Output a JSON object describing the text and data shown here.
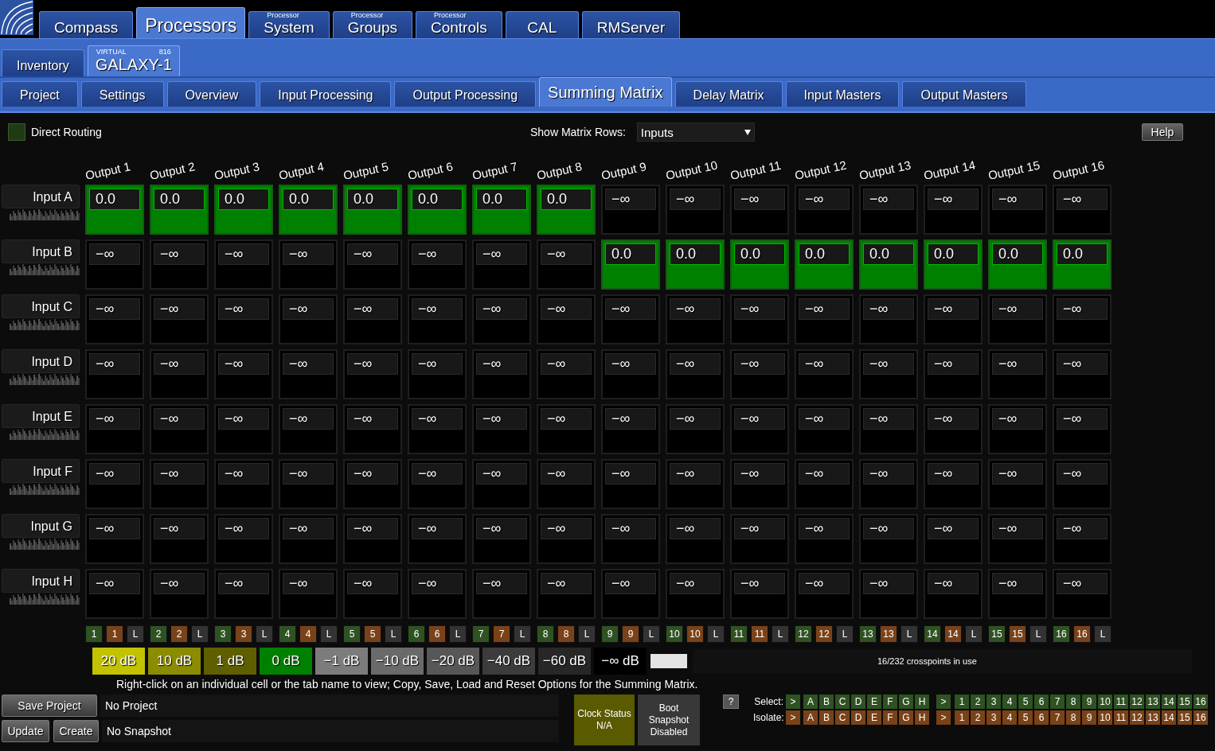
{
  "top_tabs": [
    {
      "label": "Compass",
      "selected": false
    },
    {
      "label": "Processors",
      "selected": true
    },
    {
      "caption": "Processor",
      "label": "System",
      "selected": false
    },
    {
      "caption": "Processor",
      "label": "Groups",
      "selected": false
    },
    {
      "caption": "Processor",
      "label": "Controls",
      "selected": false
    },
    {
      "label": "CAL",
      "selected": false
    },
    {
      "label": "RMServer",
      "selected": false
    }
  ],
  "device_tabs": [
    {
      "label": "Inventory",
      "selected": false
    },
    {
      "caption": "VIRTUAL",
      "badge": "816",
      "label": "GALAXY-1",
      "selected": true
    }
  ],
  "page_tabs": [
    {
      "label": "Project",
      "selected": false
    },
    {
      "label": "Settings",
      "selected": false
    },
    {
      "label": "Overview",
      "selected": false
    },
    {
      "label": "Input Processing",
      "selected": false
    },
    {
      "label": "Output Processing",
      "selected": false
    },
    {
      "label": "Summing Matrix",
      "selected": true
    },
    {
      "label": "Delay Matrix",
      "selected": false
    },
    {
      "label": "Input Masters",
      "selected": false
    },
    {
      "label": "Output Masters",
      "selected": false
    }
  ],
  "toolbar": {
    "direct_routing": {
      "label": "Direct Routing",
      "checked": false
    },
    "matrix_rows": {
      "label": "Show Matrix Rows:",
      "value": "Inputs"
    },
    "help": "Help"
  },
  "matrix": {
    "columns": [
      "Output 1",
      "Output 2",
      "Output 3",
      "Output 4",
      "Output 5",
      "Output 6",
      "Output 7",
      "Output 8",
      "Output 9",
      "Output 10",
      "Output 11",
      "Output 12",
      "Output 13",
      "Output 14",
      "Output 15",
      "Output 16"
    ],
    "rows": [
      {
        "label": "Input A",
        "cells": [
          {
            "value": "0.0",
            "on": true
          },
          {
            "value": "0.0",
            "on": true
          },
          {
            "value": "0.0",
            "on": true
          },
          {
            "value": "0.0",
            "on": true
          },
          {
            "value": "0.0",
            "on": true
          },
          {
            "value": "0.0",
            "on": true
          },
          {
            "value": "0.0",
            "on": true
          },
          {
            "value": "0.0",
            "on": true
          },
          {
            "value": "−∞",
            "on": false
          },
          {
            "value": "−∞",
            "on": false
          },
          {
            "value": "−∞",
            "on": false
          },
          {
            "value": "−∞",
            "on": false
          },
          {
            "value": "−∞",
            "on": false
          },
          {
            "value": "−∞",
            "on": false
          },
          {
            "value": "−∞",
            "on": false
          },
          {
            "value": "−∞",
            "on": false
          }
        ]
      },
      {
        "label": "Input B",
        "cells": [
          {
            "value": "−∞",
            "on": false
          },
          {
            "value": "−∞",
            "on": false
          },
          {
            "value": "−∞",
            "on": false
          },
          {
            "value": "−∞",
            "on": false
          },
          {
            "value": "−∞",
            "on": false
          },
          {
            "value": "−∞",
            "on": false
          },
          {
            "value": "−∞",
            "on": false
          },
          {
            "value": "−∞",
            "on": false
          },
          {
            "value": "0.0",
            "on": true
          },
          {
            "value": "0.0",
            "on": true
          },
          {
            "value": "0.0",
            "on": true
          },
          {
            "value": "0.0",
            "on": true
          },
          {
            "value": "0.0",
            "on": true
          },
          {
            "value": "0.0",
            "on": true
          },
          {
            "value": "0.0",
            "on": true
          },
          {
            "value": "0.0",
            "on": true
          }
        ]
      },
      {
        "label": "Input C",
        "cells": [
          {
            "value": "−∞",
            "on": false
          },
          {
            "value": "−∞",
            "on": false
          },
          {
            "value": "−∞",
            "on": false
          },
          {
            "value": "−∞",
            "on": false
          },
          {
            "value": "−∞",
            "on": false
          },
          {
            "value": "−∞",
            "on": false
          },
          {
            "value": "−∞",
            "on": false
          },
          {
            "value": "−∞",
            "on": false
          },
          {
            "value": "−∞",
            "on": false
          },
          {
            "value": "−∞",
            "on": false
          },
          {
            "value": "−∞",
            "on": false
          },
          {
            "value": "−∞",
            "on": false
          },
          {
            "value": "−∞",
            "on": false
          },
          {
            "value": "−∞",
            "on": false
          },
          {
            "value": "−∞",
            "on": false
          },
          {
            "value": "−∞",
            "on": false
          }
        ]
      },
      {
        "label": "Input D",
        "cells": [
          {
            "value": "−∞",
            "on": false
          },
          {
            "value": "−∞",
            "on": false
          },
          {
            "value": "−∞",
            "on": false
          },
          {
            "value": "−∞",
            "on": false
          },
          {
            "value": "−∞",
            "on": false
          },
          {
            "value": "−∞",
            "on": false
          },
          {
            "value": "−∞",
            "on": false
          },
          {
            "value": "−∞",
            "on": false
          },
          {
            "value": "−∞",
            "on": false
          },
          {
            "value": "−∞",
            "on": false
          },
          {
            "value": "−∞",
            "on": false
          },
          {
            "value": "−∞",
            "on": false
          },
          {
            "value": "−∞",
            "on": false
          },
          {
            "value": "−∞",
            "on": false
          },
          {
            "value": "−∞",
            "on": false
          },
          {
            "value": "−∞",
            "on": false
          }
        ]
      },
      {
        "label": "Input E",
        "cells": [
          {
            "value": "−∞",
            "on": false
          },
          {
            "value": "−∞",
            "on": false
          },
          {
            "value": "−∞",
            "on": false
          },
          {
            "value": "−∞",
            "on": false
          },
          {
            "value": "−∞",
            "on": false
          },
          {
            "value": "−∞",
            "on": false
          },
          {
            "value": "−∞",
            "on": false
          },
          {
            "value": "−∞",
            "on": false
          },
          {
            "value": "−∞",
            "on": false
          },
          {
            "value": "−∞",
            "on": false
          },
          {
            "value": "−∞",
            "on": false
          },
          {
            "value": "−∞",
            "on": false
          },
          {
            "value": "−∞",
            "on": false
          },
          {
            "value": "−∞",
            "on": false
          },
          {
            "value": "−∞",
            "on": false
          },
          {
            "value": "−∞",
            "on": false
          }
        ]
      },
      {
        "label": "Input F",
        "cells": [
          {
            "value": "−∞",
            "on": false
          },
          {
            "value": "−∞",
            "on": false
          },
          {
            "value": "−∞",
            "on": false
          },
          {
            "value": "−∞",
            "on": false
          },
          {
            "value": "−∞",
            "on": false
          },
          {
            "value": "−∞",
            "on": false
          },
          {
            "value": "−∞",
            "on": false
          },
          {
            "value": "−∞",
            "on": false
          },
          {
            "value": "−∞",
            "on": false
          },
          {
            "value": "−∞",
            "on": false
          },
          {
            "value": "−∞",
            "on": false
          },
          {
            "value": "−∞",
            "on": false
          },
          {
            "value": "−∞",
            "on": false
          },
          {
            "value": "−∞",
            "on": false
          },
          {
            "value": "−∞",
            "on": false
          },
          {
            "value": "−∞",
            "on": false
          }
        ]
      },
      {
        "label": "Input G",
        "cells": [
          {
            "value": "−∞",
            "on": false
          },
          {
            "value": "−∞",
            "on": false
          },
          {
            "value": "−∞",
            "on": false
          },
          {
            "value": "−∞",
            "on": false
          },
          {
            "value": "−∞",
            "on": false
          },
          {
            "value": "−∞",
            "on": false
          },
          {
            "value": "−∞",
            "on": false
          },
          {
            "value": "−∞",
            "on": false
          },
          {
            "value": "−∞",
            "on": false
          },
          {
            "value": "−∞",
            "on": false
          },
          {
            "value": "−∞",
            "on": false
          },
          {
            "value": "−∞",
            "on": false
          },
          {
            "value": "−∞",
            "on": false
          },
          {
            "value": "−∞",
            "on": false
          },
          {
            "value": "−∞",
            "on": false
          },
          {
            "value": "−∞",
            "on": false
          }
        ]
      },
      {
        "label": "Input H",
        "cells": [
          {
            "value": "−∞",
            "on": false
          },
          {
            "value": "−∞",
            "on": false
          },
          {
            "value": "−∞",
            "on": false
          },
          {
            "value": "−∞",
            "on": false
          },
          {
            "value": "−∞",
            "on": false
          },
          {
            "value": "−∞",
            "on": false
          },
          {
            "value": "−∞",
            "on": false
          },
          {
            "value": "−∞",
            "on": false
          },
          {
            "value": "−∞",
            "on": false
          },
          {
            "value": "−∞",
            "on": false
          },
          {
            "value": "−∞",
            "on": false
          },
          {
            "value": "−∞",
            "on": false
          },
          {
            "value": "−∞",
            "on": false
          },
          {
            "value": "−∞",
            "on": false
          },
          {
            "value": "−∞",
            "on": false
          },
          {
            "value": "−∞",
            "on": false
          }
        ]
      }
    ]
  },
  "output_buttons": [
    {
      "select": "1",
      "isolate": "1",
      "link": "L"
    },
    {
      "select": "2",
      "isolate": "2",
      "link": "L"
    },
    {
      "select": "3",
      "isolate": "3",
      "link": "L"
    },
    {
      "select": "4",
      "isolate": "4",
      "link": "L"
    },
    {
      "select": "5",
      "isolate": "5",
      "link": "L"
    },
    {
      "select": "6",
      "isolate": "6",
      "link": "L"
    },
    {
      "select": "7",
      "isolate": "7",
      "link": "L"
    },
    {
      "select": "8",
      "isolate": "8",
      "link": "L"
    },
    {
      "select": "9",
      "isolate": "9",
      "link": "L"
    },
    {
      "select": "10",
      "isolate": "10",
      "link": "L"
    },
    {
      "select": "11",
      "isolate": "11",
      "link": "L"
    },
    {
      "select": "12",
      "isolate": "12",
      "link": "L"
    },
    {
      "select": "13",
      "isolate": "13",
      "link": "L"
    },
    {
      "select": "14",
      "isolate": "14",
      "link": "L"
    },
    {
      "select": "15",
      "isolate": "15",
      "link": "L"
    },
    {
      "select": "16",
      "isolate": "16",
      "link": "L"
    }
  ],
  "gain_buttons": [
    {
      "label": "20 dB",
      "color": "#c2c200"
    },
    {
      "label": "10 dB",
      "color": "#8c8c00"
    },
    {
      "label": "1 dB",
      "color": "#5f5f00"
    },
    {
      "label": "0 dB",
      "color": "#008000"
    },
    {
      "label": "−1 dB",
      "color": "#7c7c7c"
    },
    {
      "label": "−10 dB",
      "color": "#6a6a6a"
    },
    {
      "label": "−20 dB",
      "color": "#575757"
    },
    {
      "label": "−40 dB",
      "color": "#3c3c3c"
    },
    {
      "label": "−60 dB",
      "color": "#272727"
    },
    {
      "label": "−∞ dB",
      "color": "#000000"
    }
  ],
  "crosspoints": "16/232 crosspoints in use",
  "hint": "Right-click on an individual cell or the tab name to view; Copy, Save, Load and Reset Options for the Summing Matrix.",
  "project": {
    "button": "Save Project",
    "name": "No Project"
  },
  "snapshot": {
    "buttons": [
      "Update",
      "Create"
    ],
    "name": "No Snapshot"
  },
  "clock_status": {
    "label": "Clock Status",
    "value": "N/A"
  },
  "boot_snapshot": "Boot Snapshot Disabled",
  "help_button": "?",
  "select_rows": [
    {
      "kind": "select",
      "label": "Select:",
      "rows_toggle": ">",
      "rows": [
        "A",
        "B",
        "C",
        "D",
        "E",
        "F",
        "G",
        "H"
      ],
      "columns_toggle": ">",
      "columns": [
        "1",
        "2",
        "3",
        "4",
        "5",
        "6",
        "7",
        "8",
        "9",
        "10",
        "11",
        "12",
        "13",
        "14",
        "15",
        "16"
      ]
    },
    {
      "kind": "isolate",
      "label": "Isolate:",
      "rows_toggle": ">",
      "rows": [
        "A",
        "B",
        "C",
        "D",
        "E",
        "F",
        "G",
        "H"
      ],
      "columns_toggle": ">",
      "columns": [
        "1",
        "2",
        "3",
        "4",
        "5",
        "6",
        "7",
        "8",
        "9",
        "10",
        "11",
        "12",
        "13",
        "14",
        "15",
        "16"
      ]
    }
  ]
}
